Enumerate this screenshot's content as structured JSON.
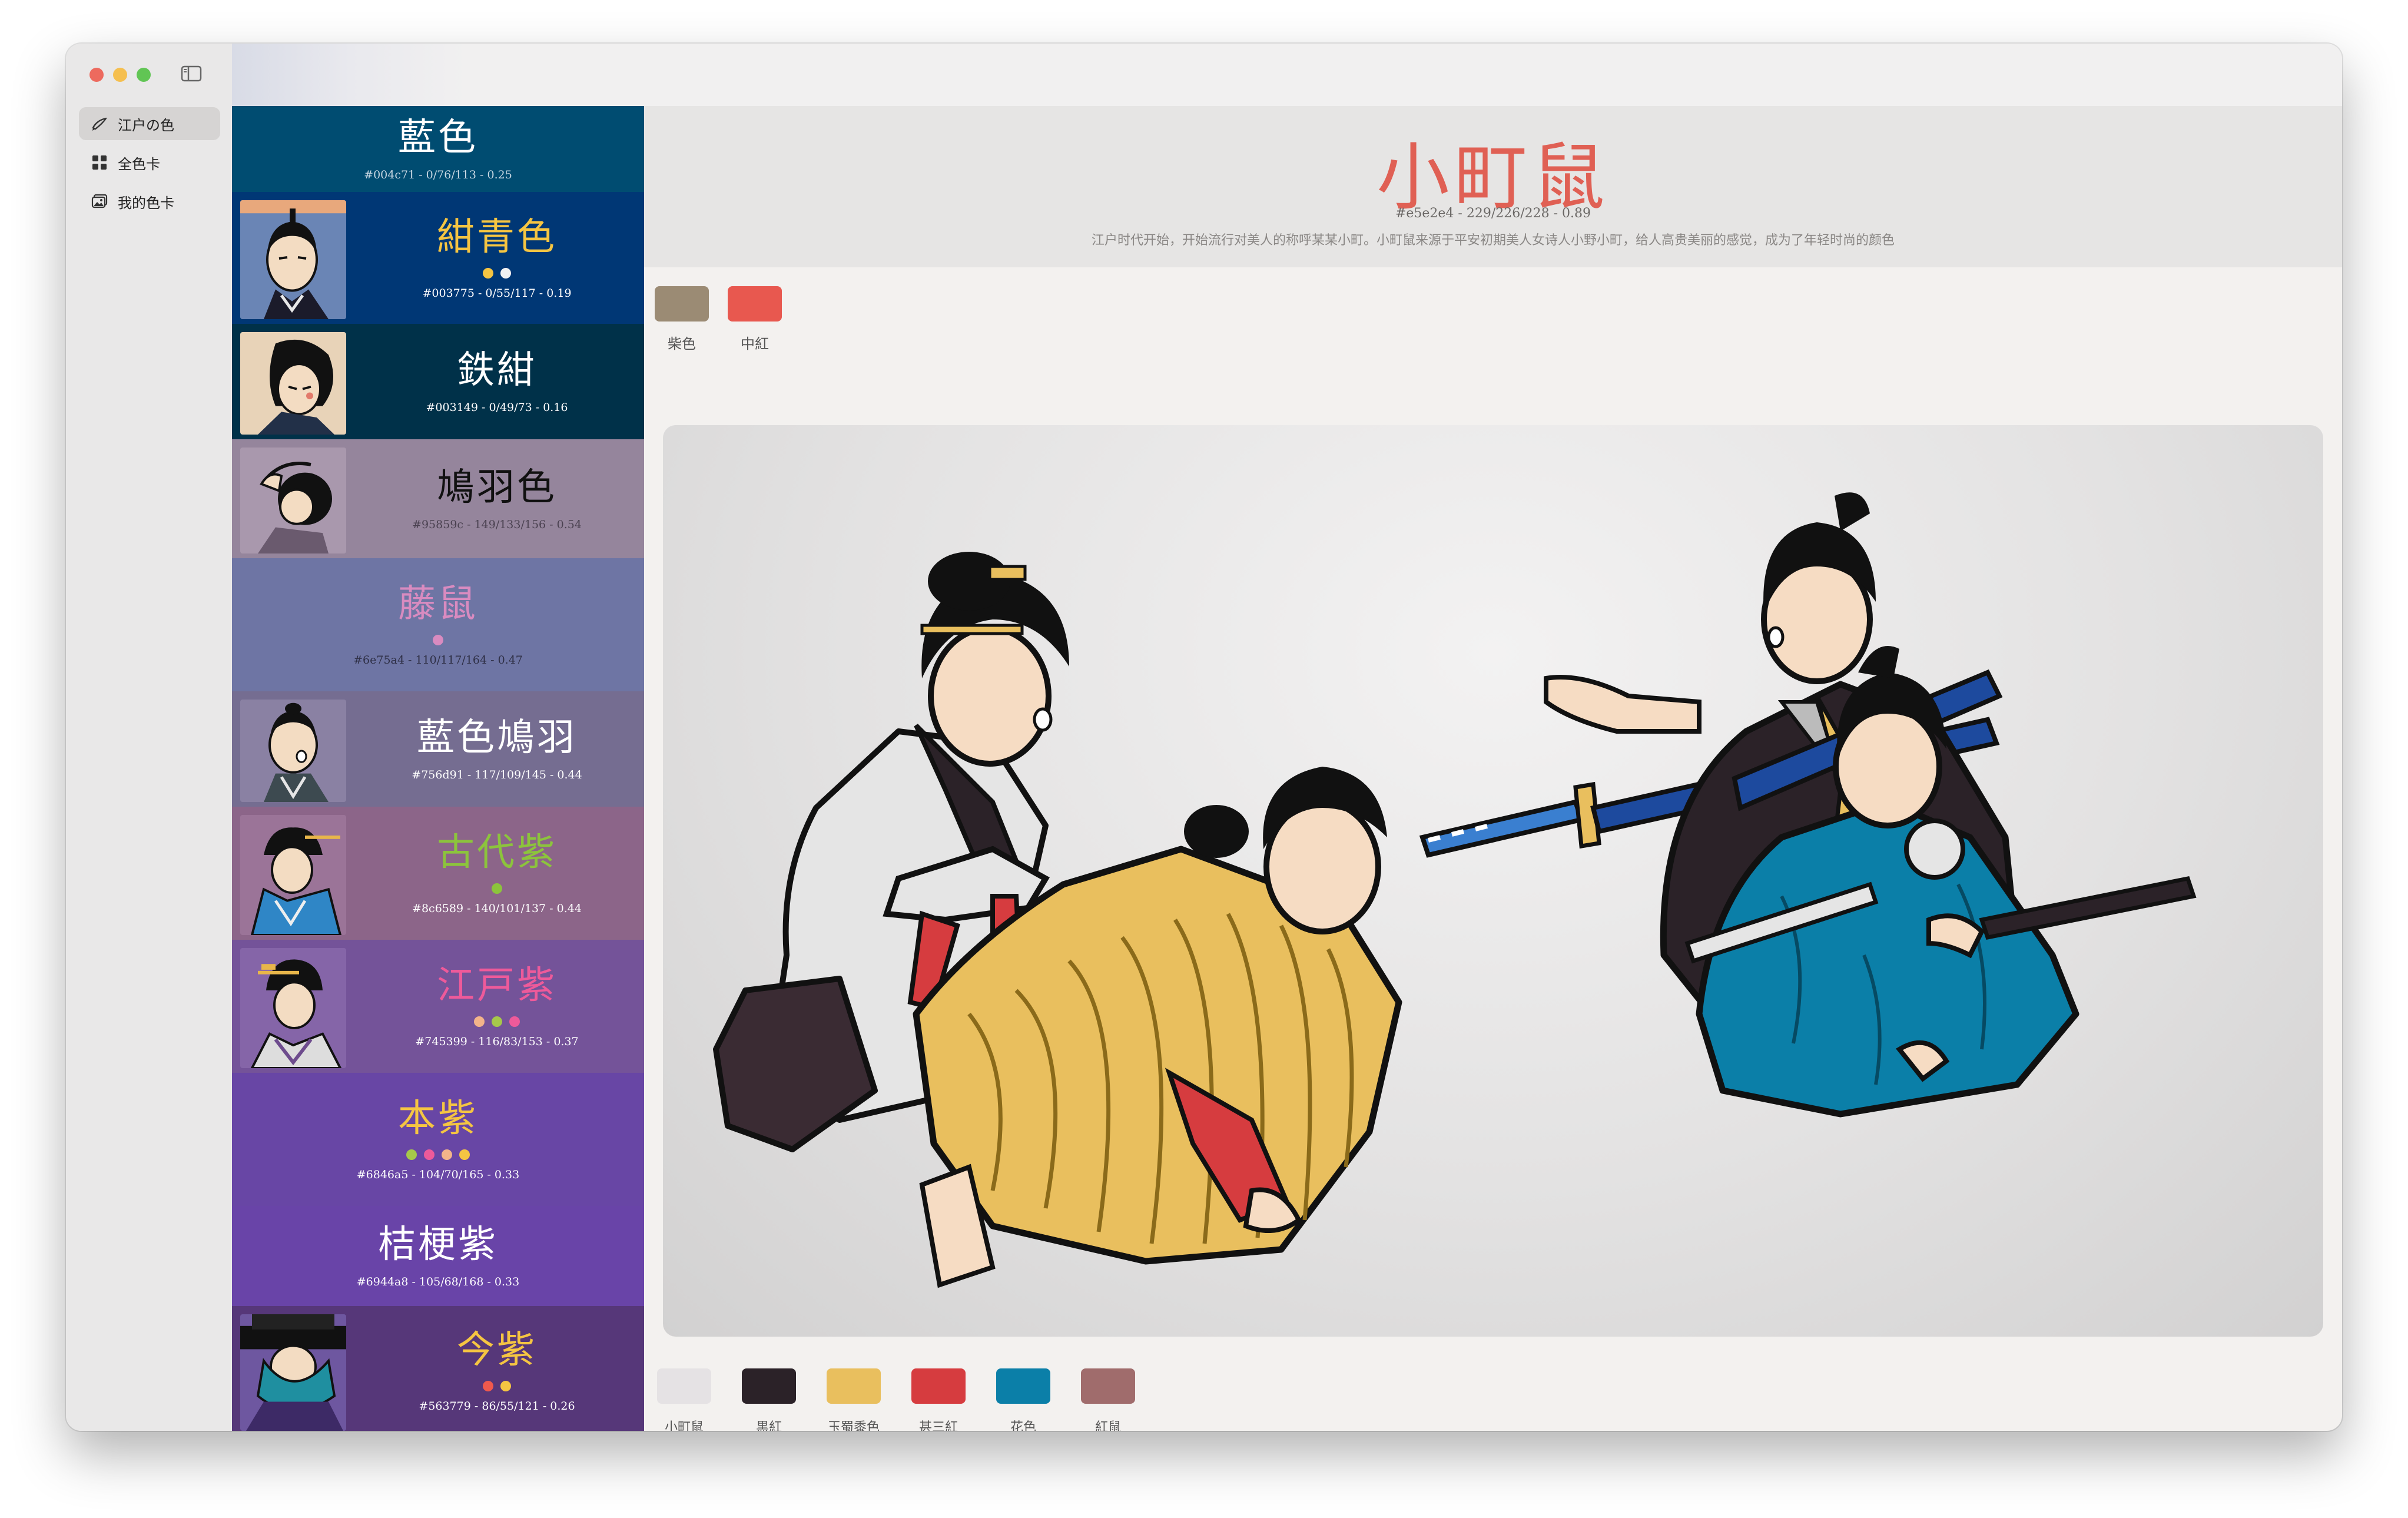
{
  "sidebar": {
    "items": [
      {
        "label": "江户の色",
        "icon": "brush-icon",
        "active": true
      },
      {
        "label": "全色卡",
        "icon": "grid-icon",
        "active": false
      },
      {
        "label": "我的色卡",
        "icon": "photos-icon",
        "active": false
      }
    ]
  },
  "colors": [
    {
      "name": "藍色",
      "info": "#004c71 - 0/76/113 - 0.25",
      "bg": "#004c71",
      "text_color": "#ffffff",
      "dots": []
    },
    {
      "name": "紺青色",
      "info": "#003775 - 0/55/117 - 0.19",
      "bg": "#003775",
      "text_color": "#f5c542",
      "dots": [
        "#f5c542",
        "#f2f2f2"
      ]
    },
    {
      "name": "鉄紺",
      "info": "#003149 - 0/49/73 - 0.16",
      "bg": "#003149",
      "text_color": "#ffffff",
      "dots": []
    },
    {
      "name": "鳩羽色",
      "info": "#95859c - 149/133/156 - 0.54",
      "bg": "#95859c",
      "text_color": "#111111",
      "dots": []
    },
    {
      "name": "藤鼠",
      "info": "#6e75a4 - 110/117/164 - 0.47",
      "bg": "#6e75a4",
      "text_color": "#d98bc0",
      "dots": [
        "#d98bc0"
      ]
    },
    {
      "name": "藍色鳩羽",
      "info": "#756d91 - 117/109/145 - 0.44",
      "bg": "#756d91",
      "text_color": "#ffffff",
      "dots": []
    },
    {
      "name": "古代紫",
      "info": "#8c6589 - 140/101/137 - 0.44",
      "bg": "#8c6589",
      "text_color": "#8cc43c",
      "dots": [
        "#8cc43c"
      ]
    },
    {
      "name": "江戸紫",
      "info": "#745399 - 116/83/153 - 0.37",
      "bg": "#745399",
      "text_color": "#ee5a9a",
      "dots": [
        "#f3b48a",
        "#a6c84a",
        "#ee5a9a"
      ]
    },
    {
      "name": "本紫",
      "info": "#6846a5 - 104/70/165 - 0.33",
      "bg": "#6846a5",
      "text_color": "#f5c542",
      "dots": [
        "#a6c84a",
        "#ee5a9a",
        "#f3b48a",
        "#f5c542"
      ]
    },
    {
      "name": "桔梗紫",
      "info": "#6944a8 - 105/68/168 - 0.33",
      "bg": "#6944a8",
      "text_color": "#ffffff",
      "dots": []
    },
    {
      "name": "今紫",
      "info": "#563779 - 86/55/121 - 0.26",
      "bg": "#563779",
      "text_color": "#f5c542",
      "dots": [
        "#f0594d",
        "#f5c542"
      ]
    }
  ],
  "detail": {
    "title": "小町鼠",
    "meta": "#e5e2e4 - 229/226/228 - 0.89",
    "description": "江户时代开始，开始流行对美人的称呼某某小町。小町鼠来源于平安初期美人女诗人小野小町，给人高贵美丽的感觉，成为了年轻时尚的颜色",
    "related": [
      {
        "label": "柴色",
        "hex": "#9b8b74"
      },
      {
        "label": "中紅",
        "hex": "#e8584f"
      }
    ],
    "palette": [
      {
        "label": "小町鼠",
        "hex": "#e5e2e4"
      },
      {
        "label": "黒紅",
        "hex": "#2b2228"
      },
      {
        "label": "玉蜀黍色",
        "hex": "#e9bf5e"
      },
      {
        "label": "甚三紅",
        "hex": "#d63c3f"
      },
      {
        "label": "花色",
        "hex": "#0b7fa8"
      },
      {
        "label": "紅鼠",
        "hex": "#a06c6c"
      }
    ]
  }
}
